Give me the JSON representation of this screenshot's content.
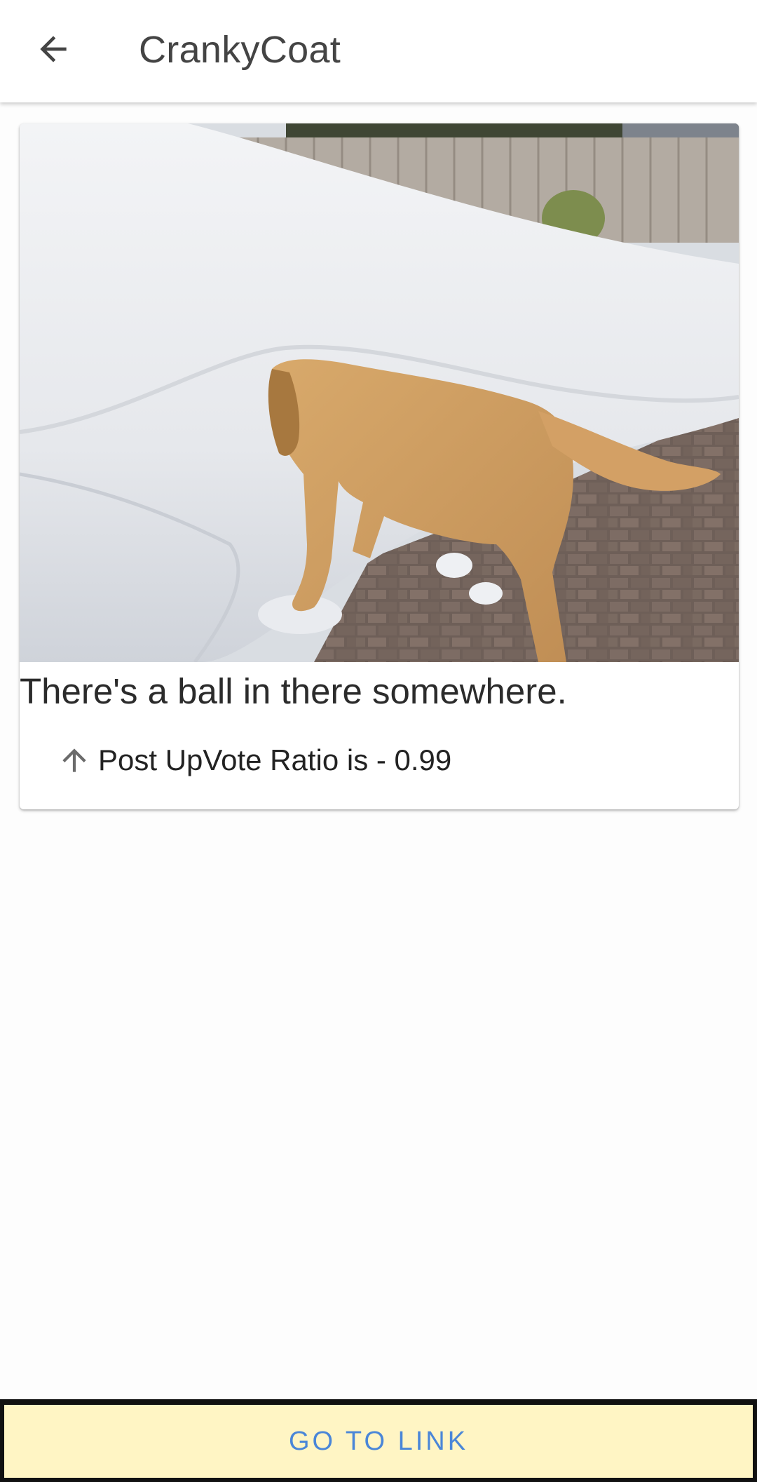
{
  "header": {
    "back_icon": "arrow-back-icon",
    "title": "CrankyCoat"
  },
  "post": {
    "image_description_icon": "dog-in-snow-image",
    "title": "There's a ball in there somewhere.",
    "ratio_icon": "arrow-up-icon",
    "ratio_text": "Post UpVote Ratio is - 0.99"
  },
  "footer": {
    "button_label": "GO TO LINK"
  },
  "colors": {
    "button_bg": "#fff5c4",
    "button_text": "#4a86d8",
    "title_text": "#444444"
  }
}
